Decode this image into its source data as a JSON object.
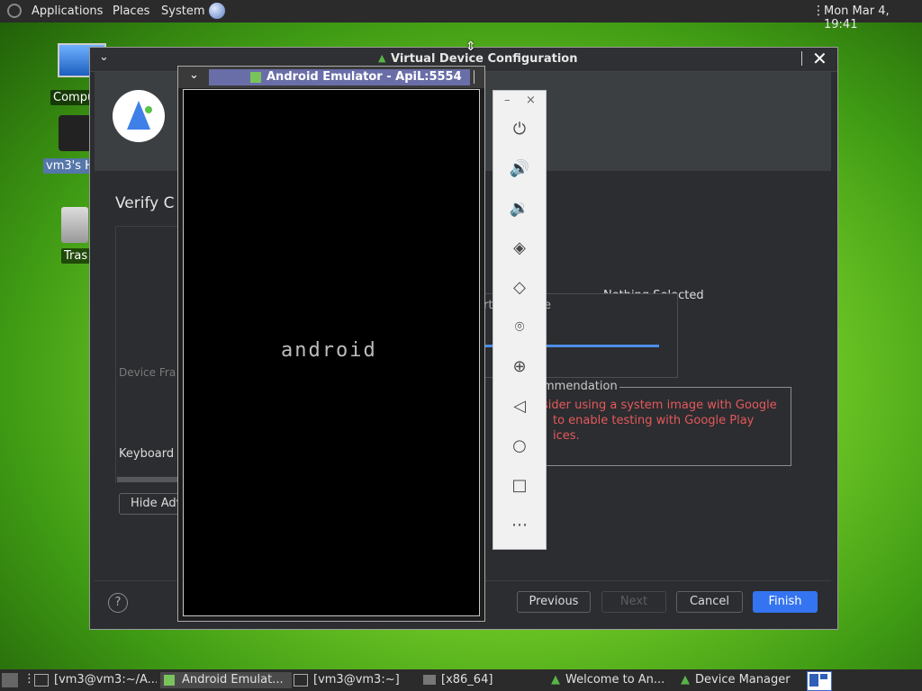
{
  "top_panel": {
    "menus": [
      "Applications",
      "Places",
      "System"
    ],
    "clock": "Mon Mar 4, 19:41"
  },
  "desktop": {
    "icons": [
      {
        "label": "Compu"
      },
      {
        "label": "vm3's H"
      },
      {
        "label": "Tras"
      }
    ]
  },
  "vdc_window": {
    "title": "Virtual Device Configuration",
    "verify_heading": "Verify C",
    "device_frame_label": "Device Fra",
    "keyboard_label": "Keyboard",
    "hide_adv_button": "Hide Adv",
    "nothing_selected": "Nothing Selected",
    "partial_label": "rt",
    "partial_label2": "e",
    "recommendation_title": "mmendation",
    "recommendation_lines": [
      "sider using a system image with Google",
      "to enable testing with Google Play",
      "ices."
    ],
    "buttons": {
      "help": "?",
      "previous": "Previous",
      "next": "Next",
      "cancel": "Cancel",
      "finish": "Finish"
    },
    "colors": {
      "finish": "#3574f0",
      "warning": "#e5585b"
    }
  },
  "emulator": {
    "title": "Android Emulator - ApiL:5554",
    "boot_text": "android"
  },
  "toolbar": {
    "minimize": "–",
    "close": "×",
    "items": [
      "power-icon",
      "volume-up-icon",
      "volume-down-icon",
      "rotate-left-icon",
      "rotate-right-icon",
      "camera-icon",
      "zoom-icon",
      "back-icon",
      "home-icon",
      "overview-icon",
      "more-icon"
    ]
  },
  "taskbar": {
    "tasks": [
      "[vm3@vm3:~/A...",
      "Android Emulat...",
      "[vm3@vm3:~]",
      "[x86_64]",
      "Welcome to An...",
      "Device Manager"
    ]
  }
}
